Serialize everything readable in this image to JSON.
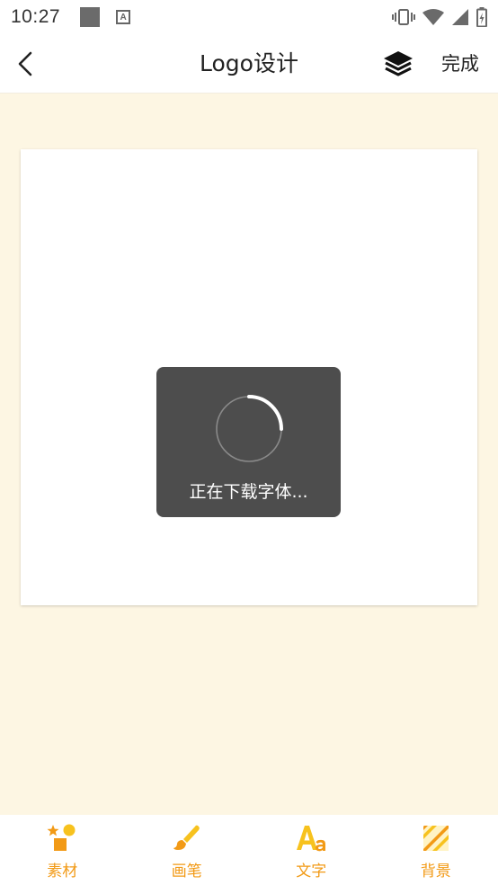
{
  "status_bar": {
    "time": "10:27",
    "icons": [
      "notification-square-icon",
      "a-badge-icon",
      "vibrate-icon",
      "wifi-icon",
      "cell-signal-icon",
      "battery-icon"
    ]
  },
  "app_bar": {
    "title": "Logo设计",
    "done_label": "完成",
    "icons": [
      "back-arrow-icon",
      "layers-icon"
    ]
  },
  "canvas": {
    "loading": {
      "message": "正在下载字体...",
      "progress": 0.25
    }
  },
  "bottom_tabs": [
    {
      "label": "素材",
      "icon": "materials-icon"
    },
    {
      "label": "画笔",
      "icon": "brush-icon"
    },
    {
      "label": "文字",
      "icon": "text-icon"
    },
    {
      "label": "背景",
      "icon": "background-icon"
    }
  ],
  "colors": {
    "accent": "#f29a16",
    "accent_yellow": "#f7c21e",
    "page_bg": "#fdf6e3",
    "toast_bg": "#4d4d4d"
  }
}
